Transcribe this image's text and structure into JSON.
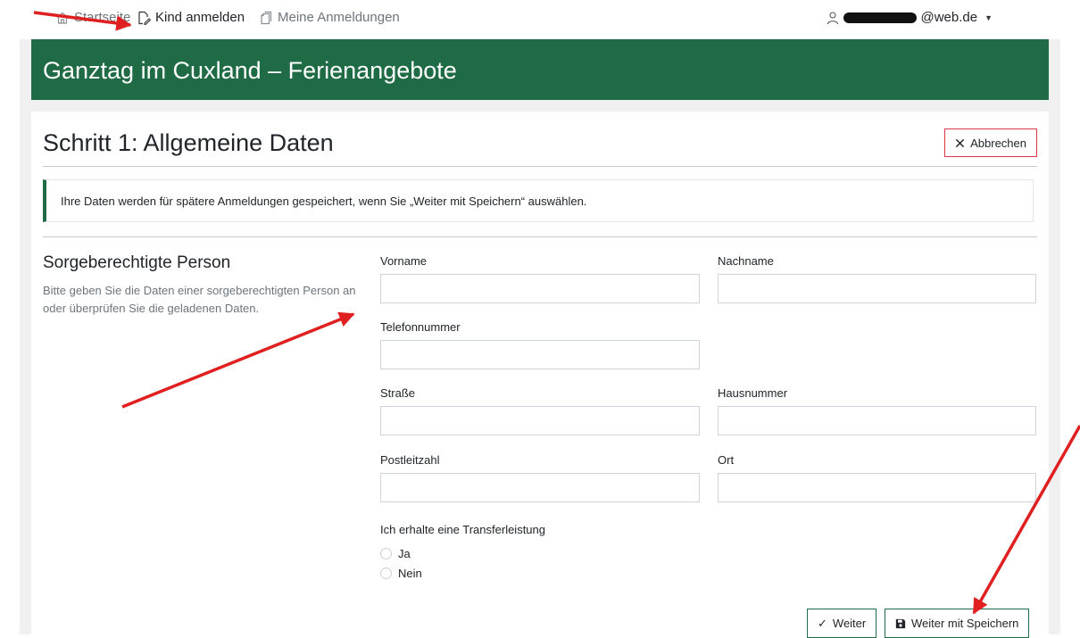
{
  "nav": {
    "home_label": "Startseite",
    "register_label": "Kind anmelden",
    "my_registrations_label": "Meine Anmeldungen",
    "user_email_suffix": "@web.de"
  },
  "header": {
    "title": "Ganztag im Cuxland – Ferienangebote"
  },
  "step": {
    "title": "Schritt 1: Allgemeine Daten",
    "cancel_label": "Abbrechen"
  },
  "alert": {
    "text": "Ihre Daten werden für spätere Anmeldungen gespeichert, wenn Sie „Weiter mit Speichern“ auswählen."
  },
  "section": {
    "title": "Sorgeberechtigte Person",
    "description": "Bitte geben Sie die Daten einer sorgeberechtigten Person an oder überprüfen Sie die geladenen Daten."
  },
  "form": {
    "vorname_label": "Vorname",
    "nachname_label": "Nachname",
    "telefon_label": "Telefonnummer",
    "strasse_label": "Straße",
    "hausnummer_label": "Hausnummer",
    "plz_label": "Postleitzahl",
    "ort_label": "Ort",
    "transfer_label": "Ich erhalte eine Transferleistung",
    "option_yes": "Ja",
    "option_no": "Nein"
  },
  "buttons": {
    "next_label": "Weiter",
    "save_next_label": "Weiter mit Speichern"
  },
  "colors": {
    "brand_green": "#1f6b45",
    "cancel_border": "#dc3545",
    "annotation_red": "#e02020"
  }
}
